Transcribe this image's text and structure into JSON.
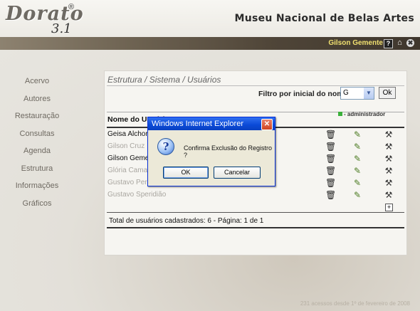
{
  "header": {
    "logo_text": "Dorato",
    "logo_reg": "®",
    "logo_version": "3.1",
    "museum_name": "Museu Nacional de Belas Artes"
  },
  "userbar": {
    "user_name": "Gilson Gemente",
    "help_glyph": "?",
    "home_glyph": "⌂",
    "close_glyph": "✖"
  },
  "sidebar": {
    "items": [
      {
        "label": "Acervo"
      },
      {
        "label": "Autores"
      },
      {
        "label": "Restauração"
      },
      {
        "label": "Consultas"
      },
      {
        "label": "Agenda"
      },
      {
        "label": "Estrutura"
      },
      {
        "label": "Informações"
      },
      {
        "label": "Gráficos"
      }
    ]
  },
  "main": {
    "breadcrumb": "Estrutura / Sistema / Usuários",
    "filter_label": "Filtro por inicial do nome:",
    "filter_value": "G",
    "filter_ok": "Ok",
    "legend_label": "- administrador",
    "column_header": "Nome do Usuário",
    "users": [
      {
        "name": "Geisa Alchorne",
        "active": true
      },
      {
        "name": "Gilson Cruz",
        "active": false
      },
      {
        "name": "Gilson Gemente",
        "active": true
      },
      {
        "name": "Glória Camargo",
        "active": false
      },
      {
        "name": "Gustavo Perdigão",
        "active": false
      },
      {
        "name": "Gustavo Speridião",
        "active": false
      }
    ],
    "add_glyph": "+",
    "total_text": "Total de usuários cadastrados: 6 - Página: 1 de 1"
  },
  "footer": {
    "access_note": "231 acessos desde 1º de fevereiro de 2008"
  },
  "dialog": {
    "title": "Windows Internet Explorer",
    "close_glyph": "✕",
    "icon_glyph": "?",
    "message": "Confirma Exclusão do Registro ?",
    "ok_label": "OK",
    "cancel_label": "Cancelar"
  },
  "colors": {
    "dialog_titlebar": "#0a49d6",
    "admin_legend": "#3bb03b",
    "user_name_highlight": "#f0e070"
  }
}
